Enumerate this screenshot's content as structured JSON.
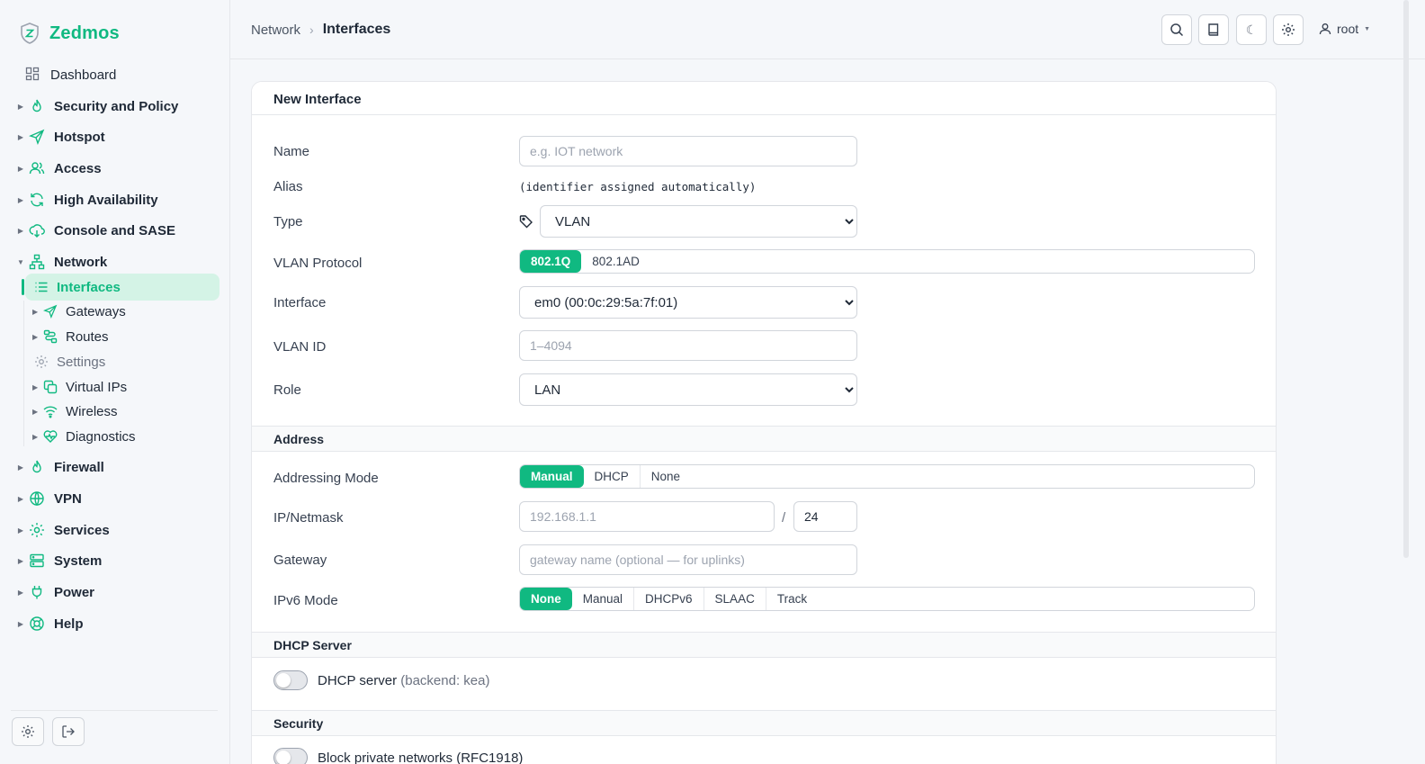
{
  "brand": {
    "name": "Zedmos"
  },
  "sidebar": {
    "items": [
      {
        "label": "Dashboard",
        "icon": "dashboard-grid-icon"
      },
      {
        "label": "Security and Policy",
        "icon": "flame-icon"
      },
      {
        "label": "Hotspot",
        "icon": "paper-plane-icon"
      },
      {
        "label": "Access",
        "icon": "users-icon"
      },
      {
        "label": "High Availability",
        "icon": "refresh-icon"
      },
      {
        "label": "Console and SASE",
        "icon": "cloud-sync-icon"
      },
      {
        "label": "Network",
        "icon": "network-icon"
      },
      {
        "label": "Firewall",
        "icon": "flame-icon"
      },
      {
        "label": "VPN",
        "icon": "globe-icon"
      },
      {
        "label": "Services",
        "icon": "gear-icon"
      },
      {
        "label": "System",
        "icon": "server-icon"
      },
      {
        "label": "Power",
        "icon": "plug-icon"
      },
      {
        "label": "Help",
        "icon": "lifebuoy-icon"
      }
    ],
    "network_children": [
      {
        "label": "Interfaces",
        "icon": "list-icon"
      },
      {
        "label": "Gateways",
        "icon": "paper-plane-icon"
      },
      {
        "label": "Routes",
        "icon": "route-icon"
      },
      {
        "label": "Settings",
        "icon": "gear-icon"
      },
      {
        "label": "Virtual IPs",
        "icon": "copy-icon"
      },
      {
        "label": "Wireless",
        "icon": "wifi-icon"
      },
      {
        "label": "Diagnostics",
        "icon": "heart-pulse-icon"
      }
    ]
  },
  "breadcrumb": {
    "parent": "Network",
    "separator": "›",
    "current": "Interfaces"
  },
  "topbar": {
    "user": "root",
    "theme_icon": "☾"
  },
  "form": {
    "title": "New Interface",
    "name": {
      "label": "Name",
      "placeholder": "e.g. IOT network",
      "value": ""
    },
    "alias": {
      "label": "Alias",
      "value": "(identifier assigned automatically)"
    },
    "type": {
      "label": "Type",
      "selected": "VLAN"
    },
    "vlan_protocol": {
      "label": "VLAN Protocol",
      "options": [
        "802.1Q",
        "802.1AD"
      ],
      "active": "802.1Q"
    },
    "interface": {
      "label": "Interface",
      "selected": "em0 (00:0c:29:5a:7f:01)"
    },
    "vlan_id": {
      "label": "VLAN ID",
      "placeholder": "1–4094"
    },
    "role": {
      "label": "Role",
      "selected": "LAN"
    },
    "address_section": "Address",
    "addressing_mode": {
      "label": "Addressing Mode",
      "options": [
        "Manual",
        "DHCP",
        "None"
      ],
      "active": "Manual"
    },
    "ip_netmask": {
      "label": "IP/Netmask",
      "ip_placeholder": "192.168.1.1",
      "slash": "/",
      "prefix": "24"
    },
    "gateway": {
      "label": "Gateway",
      "placeholder": "gateway name (optional — for uplinks)"
    },
    "ipv6_mode": {
      "label": "IPv6 Mode",
      "options": [
        "None",
        "Manual",
        "DHCPv6",
        "SLAAC",
        "Track"
      ],
      "active": "None"
    },
    "dhcp_section": "DHCP Server",
    "dhcp_server": {
      "label": "DHCP server",
      "note": "(backend: kea)",
      "enabled": false
    },
    "security_section": "Security",
    "block_private": {
      "label": "Block private networks (RFC1918)"
    }
  },
  "colors": {
    "accent": "#10b981",
    "active_bg": "#d4f3e6"
  }
}
